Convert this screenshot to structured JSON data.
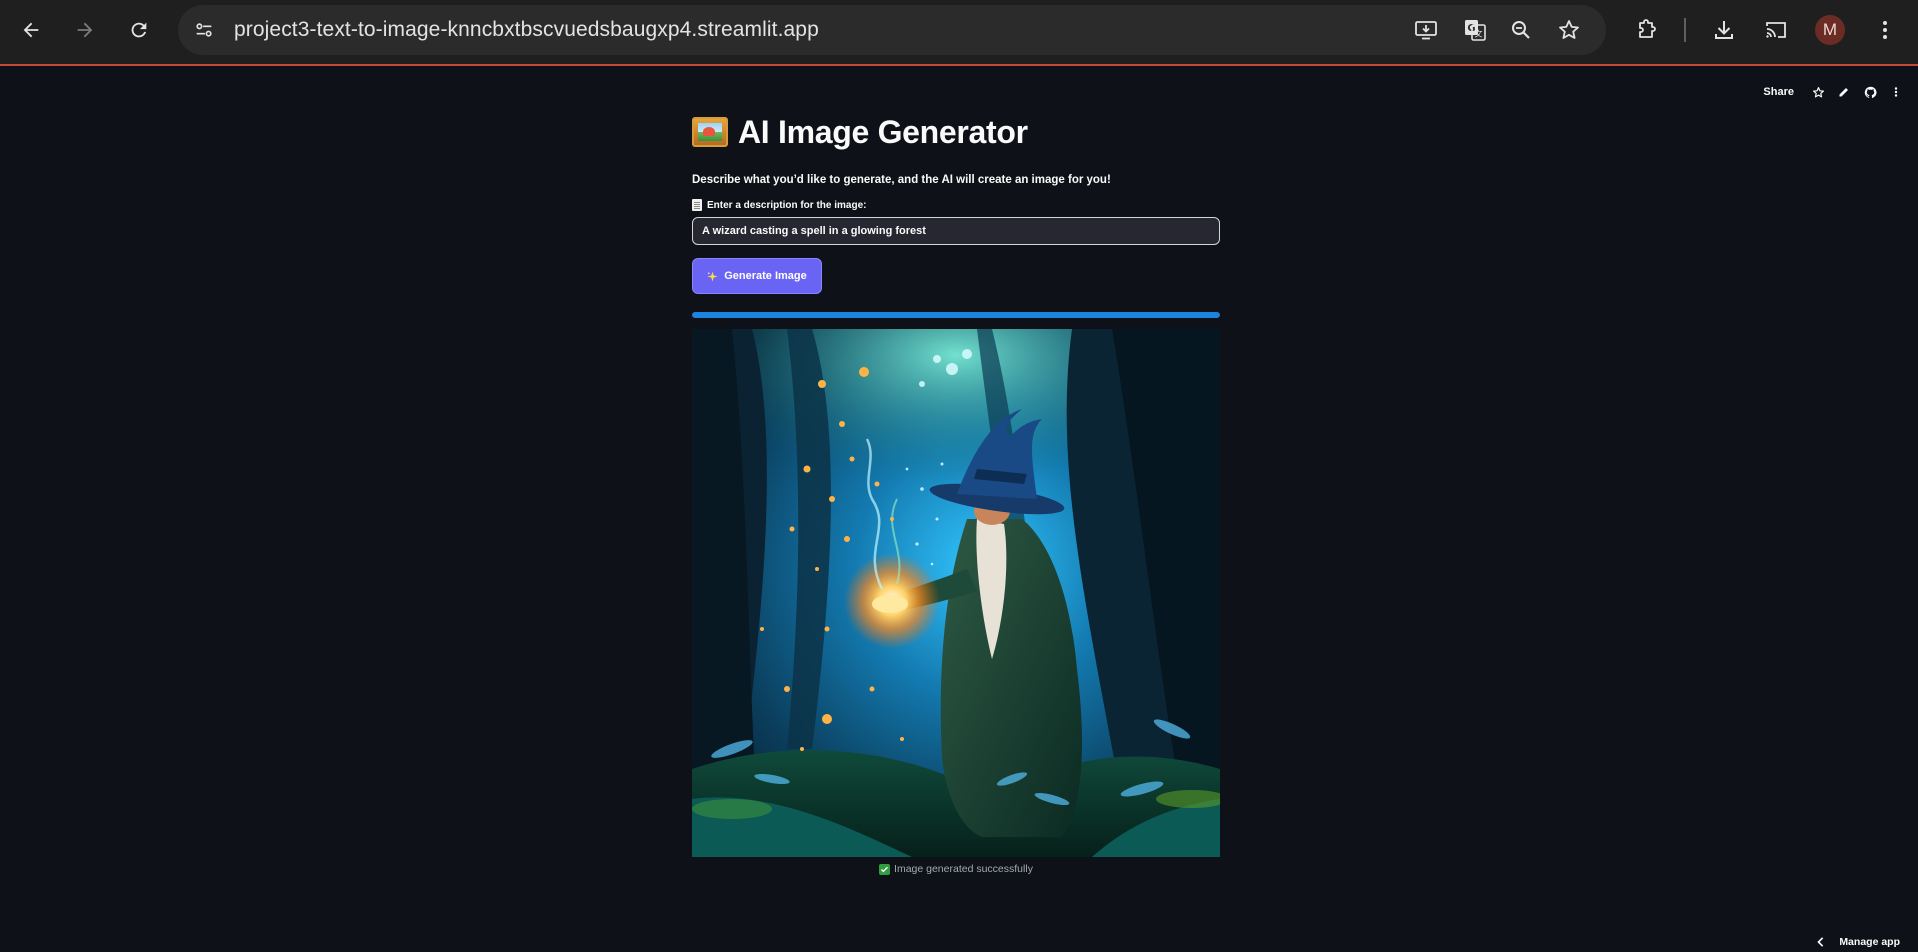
{
  "browser": {
    "url": "project3-text-to-image-knncbxtbscvuedsbaugxp4.streamlit.app",
    "profile_initial": "M",
    "icons": [
      "back-icon",
      "forward-icon",
      "reload-icon",
      "site-info-icon",
      "install-app-icon",
      "translate-icon",
      "zoom-icon",
      "bookmark-star-icon",
      "extensions-icon",
      "downloads-icon",
      "cast-icon",
      "more-vert-icon"
    ]
  },
  "toolbar": {
    "share_label": "Share",
    "icons": [
      "star-icon",
      "edit-icon",
      "github-icon",
      "more-vert-icon"
    ]
  },
  "app": {
    "title": "AI Image Generator",
    "title_icon": "framed-picture-icon",
    "subtitle": "Describe what you’d like to generate, and the AI will create an image for you!",
    "input_label": "Enter a description for the image:",
    "input_label_icon": "memo-icon",
    "input_value": "A wizard casting a spell in a glowing forest",
    "generate_button_label": "Generate Image",
    "generate_button_icon": "sparkle-icon",
    "progress": 1.0,
    "caption": "Image generated successfully",
    "caption_icon": "check-icon"
  },
  "footer": {
    "manage_label": "Manage app"
  },
  "colors": {
    "background": "#0e1117",
    "button": "#6a64f5",
    "progress": "#1c83e1",
    "input_bg": "#262730"
  }
}
